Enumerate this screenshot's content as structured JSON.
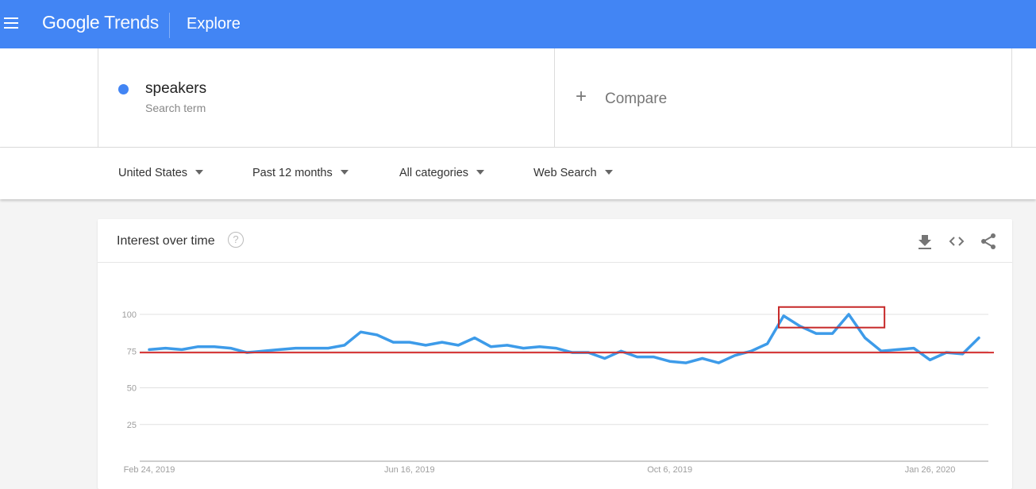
{
  "header": {
    "menu_icon": "hamburger-menu-icon",
    "logo_google": "Google",
    "logo_trends": "Trends",
    "section": "Explore"
  },
  "terms": {
    "term": {
      "name": "speakers",
      "subtitle": "Search term",
      "color": "#4285f4"
    },
    "compare": {
      "icon": "plus-icon",
      "label": "Compare"
    }
  },
  "filters": [
    {
      "label": "United States"
    },
    {
      "label": "Past 12 months"
    },
    {
      "label": "All categories"
    },
    {
      "label": "Web Search"
    }
  ],
  "card": {
    "title": "Interest over time",
    "help_icon": "?",
    "actions": [
      "download-icon",
      "embed-code-icon",
      "share-icon"
    ]
  },
  "chart_data": {
    "type": "line",
    "title": "Interest over time",
    "xlabel": "",
    "ylabel": "",
    "ylim": [
      0,
      100
    ],
    "yticks": [
      25,
      50,
      75,
      100
    ],
    "grid": true,
    "x_tick_labels": [
      "Feb 24, 2019",
      "Jun 16, 2019",
      "Oct 6, 2019",
      "Jan 26, 2020"
    ],
    "x_tick_indices": [
      0,
      16,
      32,
      48
    ],
    "series": [
      {
        "name": "speakers",
        "color": "#3d9be9",
        "values": [
          76,
          77,
          76,
          78,
          78,
          77,
          74,
          75,
          76,
          77,
          77,
          77,
          79,
          88,
          86,
          81,
          81,
          79,
          81,
          79,
          84,
          78,
          79,
          77,
          78,
          77,
          74,
          74,
          70,
          75,
          71,
          71,
          68,
          67,
          70,
          67,
          72,
          75,
          80,
          99,
          92,
          87,
          87,
          100,
          84,
          75,
          76,
          77,
          69,
          74,
          73,
          84
        ]
      }
    ],
    "annotations": {
      "reference_line": {
        "value": 74,
        "color": "#d32f2f"
      },
      "highlight_box": {
        "from_index": 38.7,
        "to_index": 45.2,
        "y_from": 91,
        "y_to": 105,
        "color": "#c62828"
      }
    }
  }
}
